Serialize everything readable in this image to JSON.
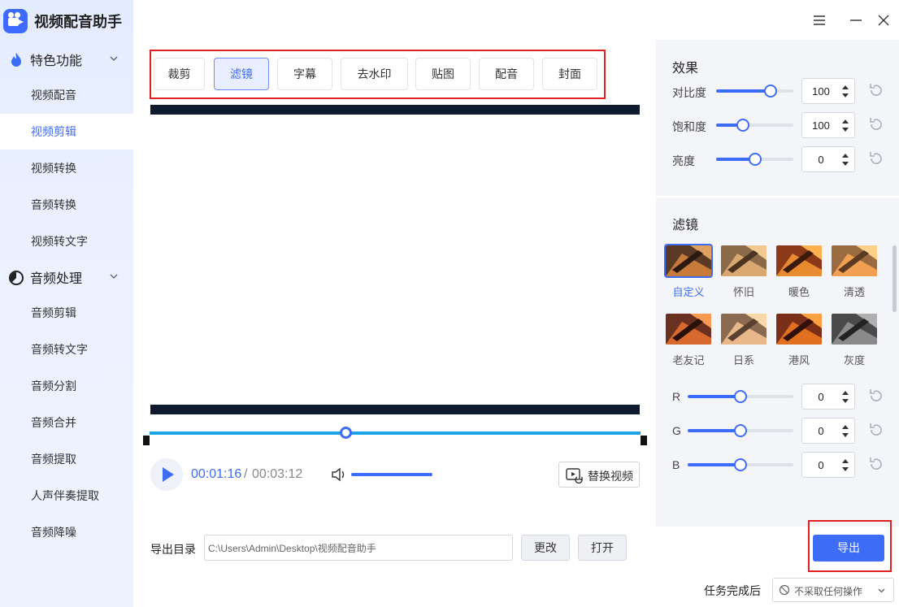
{
  "app": {
    "title": "视频配音助手"
  },
  "sidebar": {
    "groups": [
      {
        "label": "特色功能",
        "icon": "flame-icon",
        "items": [
          {
            "label": "视频配音",
            "active": false
          },
          {
            "label": "视频剪辑",
            "active": true
          },
          {
            "label": "视频转换",
            "active": false
          },
          {
            "label": "音频转换",
            "active": false
          },
          {
            "label": "视频转文字",
            "active": false
          }
        ]
      },
      {
        "label": "音频处理",
        "icon": "timer-icon",
        "items": [
          {
            "label": "音频剪辑",
            "active": false
          },
          {
            "label": "音频转文字",
            "active": false
          },
          {
            "label": "音频分割",
            "active": false
          },
          {
            "label": "音频合并",
            "active": false
          },
          {
            "label": "音频提取",
            "active": false
          },
          {
            "label": "人声伴奏提取",
            "active": false
          },
          {
            "label": "音频降噪",
            "active": false
          }
        ]
      }
    ]
  },
  "tool_tabs": [
    {
      "label": "裁剪",
      "active": false
    },
    {
      "label": "滤镜",
      "active": true
    },
    {
      "label": "字幕",
      "active": false
    },
    {
      "label": "去水印",
      "active": false
    },
    {
      "label": "贴图",
      "active": false
    },
    {
      "label": "配音",
      "active": false
    },
    {
      "label": "封面",
      "active": false
    }
  ],
  "player": {
    "current_time": "00:01:16",
    "separator": "/",
    "total_time": "00:03:12",
    "progress": 0.4,
    "volume": 1.0,
    "replace_label": "替换视频"
  },
  "effects": {
    "title": "效果",
    "rows": [
      {
        "label": "对比度",
        "value": "100",
        "level": 0.7
      },
      {
        "label": "饱和度",
        "value": "100",
        "level": 0.35
      },
      {
        "label": "亮度",
        "value": "0",
        "level": 0.5
      }
    ]
  },
  "filters": {
    "title": "滤镜",
    "items": [
      {
        "name": "自定义",
        "selected": true
      },
      {
        "name": "怀旧",
        "selected": false
      },
      {
        "name": "暖色",
        "selected": false
      },
      {
        "name": "清透",
        "selected": false
      },
      {
        "name": "老友记",
        "selected": false
      },
      {
        "name": "日系",
        "selected": false
      },
      {
        "name": "港风",
        "selected": false
      },
      {
        "name": "灰度",
        "selected": false
      }
    ]
  },
  "rgb": [
    {
      "label": "R",
      "value": "0",
      "level": 0.5
    },
    {
      "label": "G",
      "value": "0",
      "level": 0.5
    },
    {
      "label": "B",
      "value": "0",
      "level": 0.5
    }
  ],
  "export": {
    "dir_label": "导出目录",
    "path": "C:\\Users\\Admin\\Desktop\\视频配音助手",
    "change_label": "更改",
    "open_label": "打开",
    "export_label": "导出",
    "after_label": "任务完成后",
    "after_value": "不采取任何操作"
  },
  "colors": {
    "accent": "#3d6cf6",
    "highlight": "#e02020",
    "timeline": "#1aa6e6",
    "letterbox": "#0f1a2e"
  }
}
